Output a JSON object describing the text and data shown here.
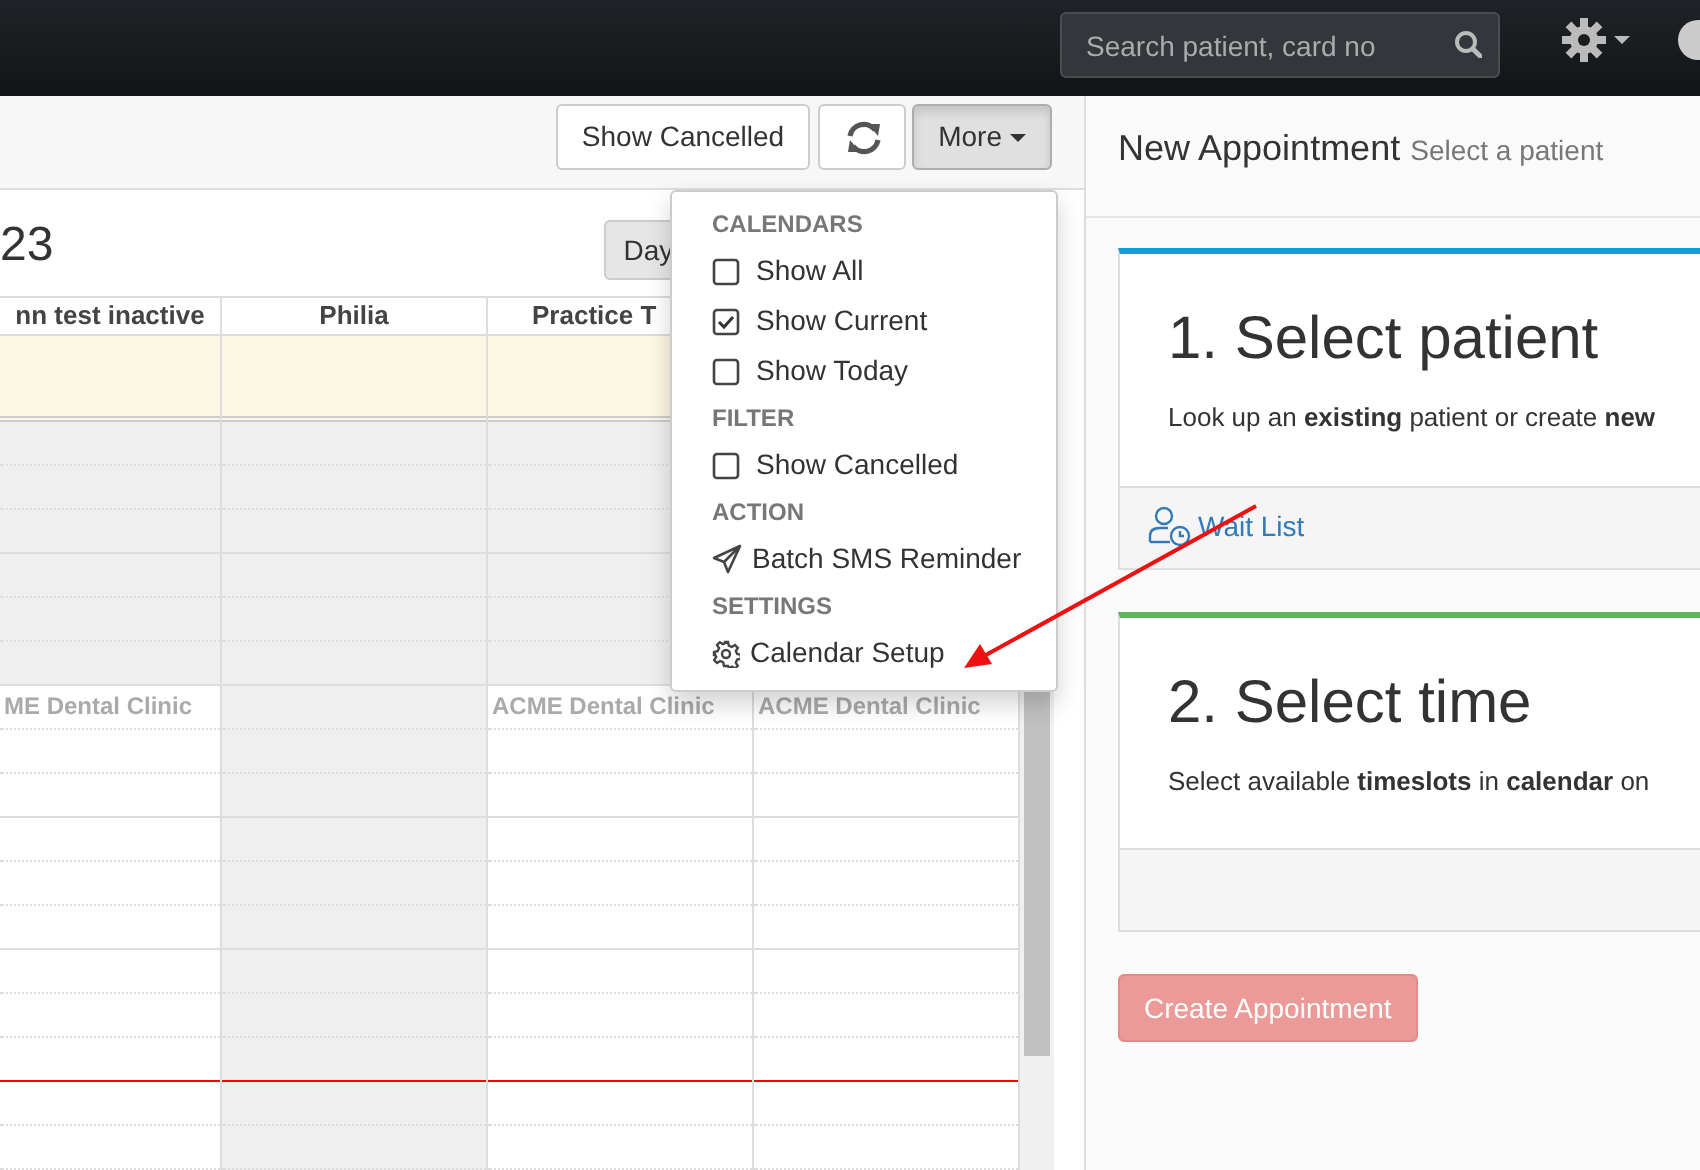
{
  "navbar": {
    "search": {
      "placeholder": "Search patient, card no"
    }
  },
  "toolbar": {
    "buttons": [
      {
        "label": "Show Cancelled",
        "kind": "text",
        "active": false
      },
      {
        "kind": "refresh",
        "active": false
      },
      {
        "label": "More",
        "kind": "dropdown",
        "active": true
      }
    ]
  },
  "calendar": {
    "title": "23",
    "view_button": "Day",
    "current_time_marker": true,
    "columns": [
      {
        "header": "nn test inactive",
        "available": true,
        "label": "ME Dental Clinic"
      },
      {
        "header": "Philia",
        "available": false
      },
      {
        "header": "Practice T",
        "available": true,
        "label": "ACME Dental Clinic"
      },
      {
        "available": true,
        "label": "ACME Dental Clinic"
      }
    ]
  },
  "more_menu": {
    "sections": [
      {
        "header": "CALENDARS",
        "items": [
          {
            "kind": "checkbox",
            "label": "Show All",
            "checked": false
          },
          {
            "kind": "checkbox",
            "label": "Show Current",
            "checked": true
          },
          {
            "kind": "checkbox",
            "label": "Show Today",
            "checked": false
          }
        ]
      },
      {
        "header": "FILTER",
        "items": [
          {
            "kind": "checkbox",
            "label": "Show Cancelled",
            "checked": false
          }
        ]
      },
      {
        "header": "ACTION",
        "items": [
          {
            "kind": "send",
            "label": "Batch SMS Reminder"
          }
        ]
      },
      {
        "header": "SETTINGS",
        "items": [
          {
            "kind": "gear",
            "label": "Calendar Setup"
          }
        ]
      }
    ]
  },
  "new_appointment": {
    "title": "New Appointment",
    "subtitle": "Select a patient",
    "steps": [
      {
        "title": "1. Select patient",
        "text": "Look up an **existing** patient or create **new**",
        "color": "#1a9bd7",
        "footer_link": "Wait List"
      },
      {
        "title": "2. Select time",
        "text": "Select available **timeslots** in **calendar** on",
        "color": "#5cb85c"
      }
    ],
    "create_button": {
      "label": "Create Appointment",
      "disabled": true
    }
  },
  "annotation": {
    "kind": "arrow",
    "color": "#ee1111"
  }
}
